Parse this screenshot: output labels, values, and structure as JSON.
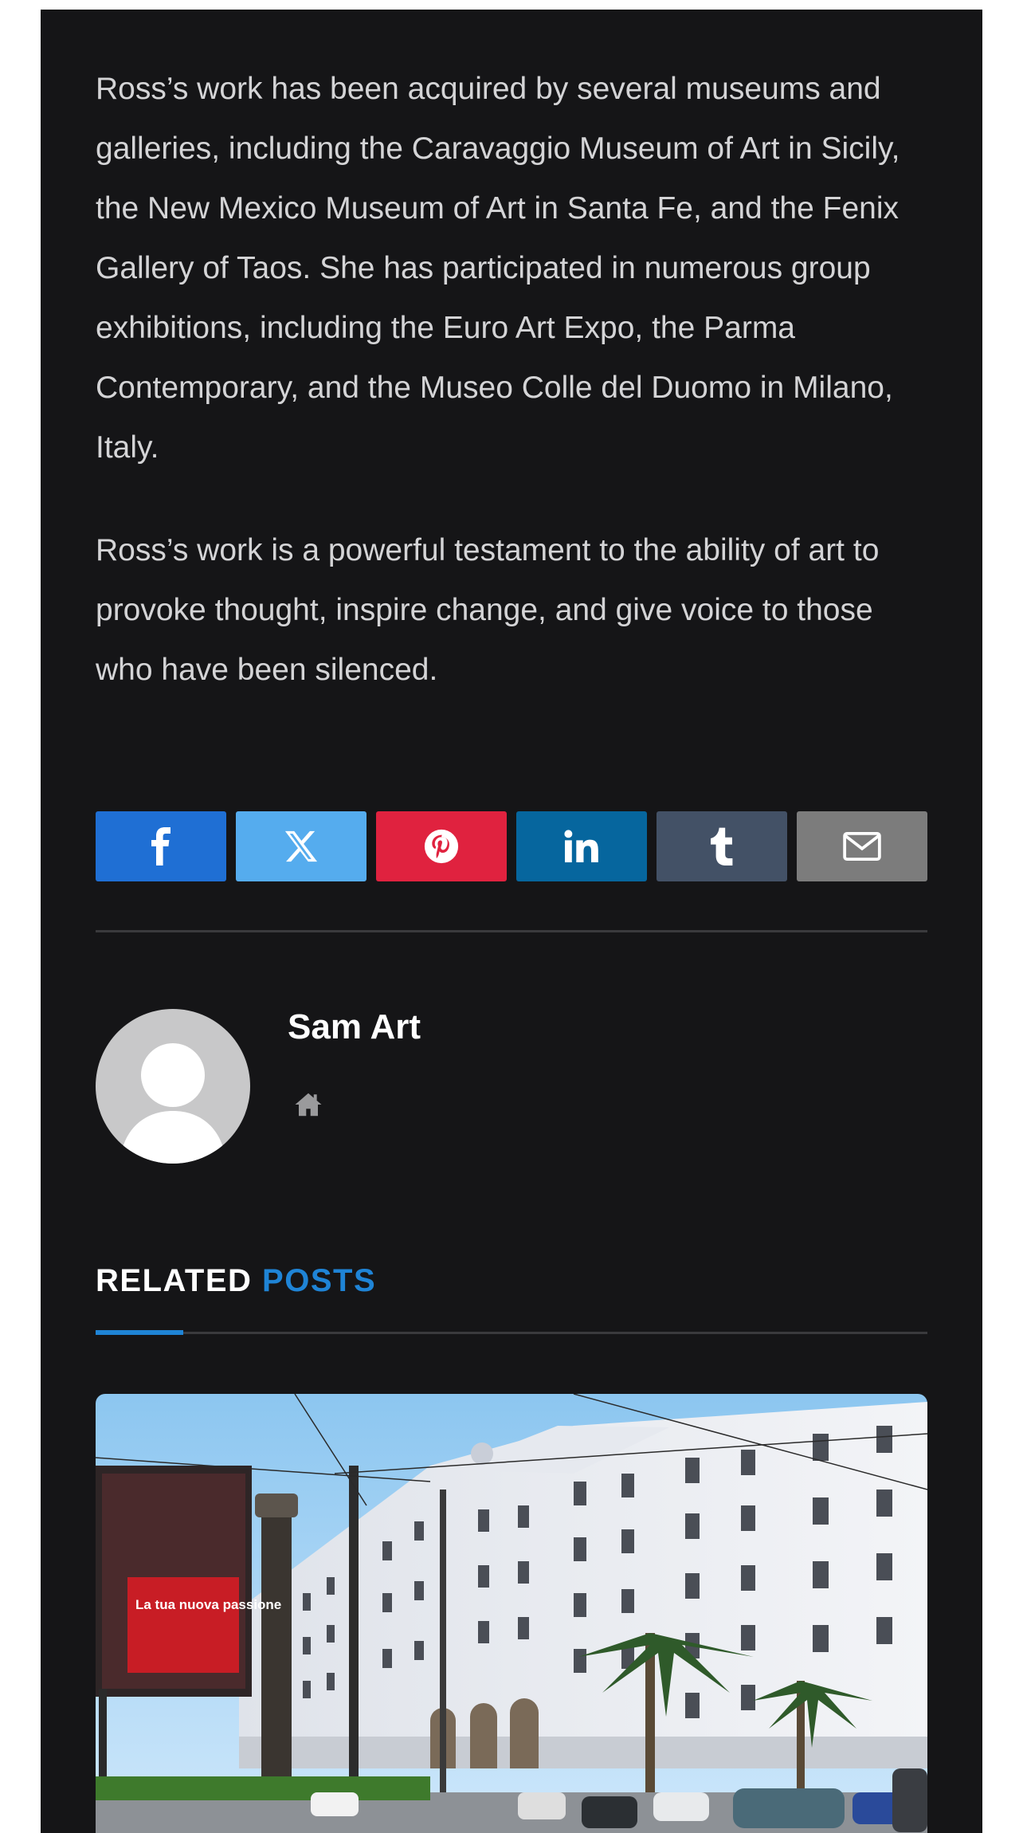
{
  "article": {
    "paragraphs": [
      "Ross’s work has been acquired by several museums and galleries, including the Caravaggio Museum of Art in Sicily, the New Mexico Museum of Art in Santa Fe, and the Fenix Gallery of Taos. She has participated in numerous group exhibitions, including the Euro Art Expo, the Parma Contemporary, and the Museo Colle del Duomo in Milano, Italy.",
      "Ross’s work is a powerful testament to the ability of art to provoke thought, inspire change, and give voice to those who have been silenced."
    ]
  },
  "share": {
    "buttons": [
      {
        "icon": "facebook-icon",
        "color": "#1f6fd4"
      },
      {
        "icon": "x-twitter-icon",
        "color": "#55acee"
      },
      {
        "icon": "pinterest-icon",
        "color": "#e0223f"
      },
      {
        "icon": "linkedin-icon",
        "color": "#06669e"
      },
      {
        "icon": "tumblr-icon",
        "color": "#435166"
      },
      {
        "icon": "email-icon",
        "color": "#7c7c7c"
      }
    ]
  },
  "author": {
    "name": "Sam Art",
    "avatar_icon": "avatar-placeholder-icon",
    "website_icon": "home-icon"
  },
  "related": {
    "heading_prefix": "RELATED",
    "heading_accent": "POSTS",
    "accent_color": "#1f84d6",
    "first_post": {
      "ad_banner_text": "La tua nuova passione"
    }
  }
}
